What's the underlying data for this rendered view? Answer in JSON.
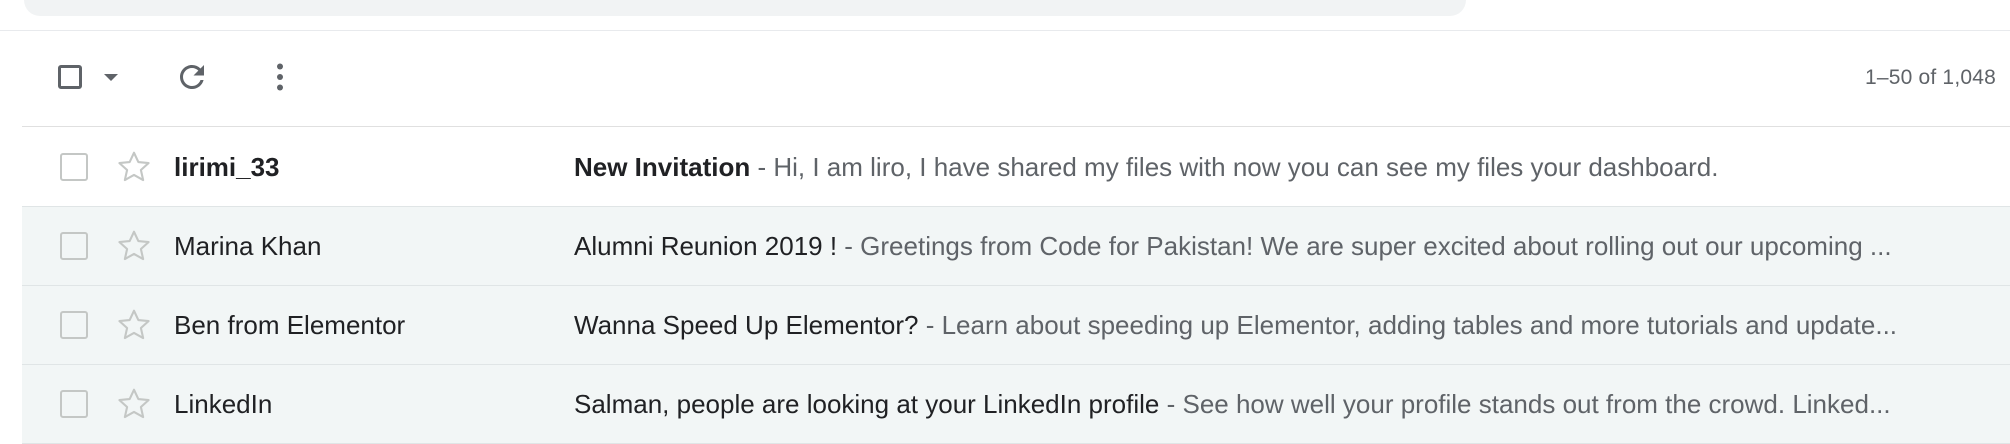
{
  "toolbar": {
    "select_icon": "checkbox-icon",
    "caret_icon": "caret-down-icon",
    "refresh_icon": "refresh-icon",
    "more_icon": "more-vert-icon",
    "pagination": "1–50 of 1,048"
  },
  "emails": [
    {
      "sender": "lirimi_33",
      "subject": "New Invitation",
      "snippet": " - Hi, I am liro, I have shared my files with now you can see my files your dashboard.",
      "unread": true
    },
    {
      "sender": "Marina Khan",
      "subject": "Alumni Reunion 2019 !",
      "snippet": " - Greetings from Code for Pakistan! We are super excited about rolling out our upcoming ...",
      "unread": false
    },
    {
      "sender": "Ben from Elementor",
      "subject": "Wanna Speed Up Elementor?",
      "snippet": " - Learn about speeding up Elementor, adding tables and more tutorials and update...",
      "unread": false
    },
    {
      "sender": "LinkedIn",
      "subject": "Salman, people are looking at your LinkedIn profile",
      "snippet": " - See how well your profile stands out from the crowd. Linked...",
      "unread": false
    }
  ],
  "colors": {
    "read_row_bg": "#f2f6f6",
    "unread_row_bg": "#ffffff",
    "icon_gray": "#5f6368",
    "star_gray": "#c4c7c5"
  }
}
